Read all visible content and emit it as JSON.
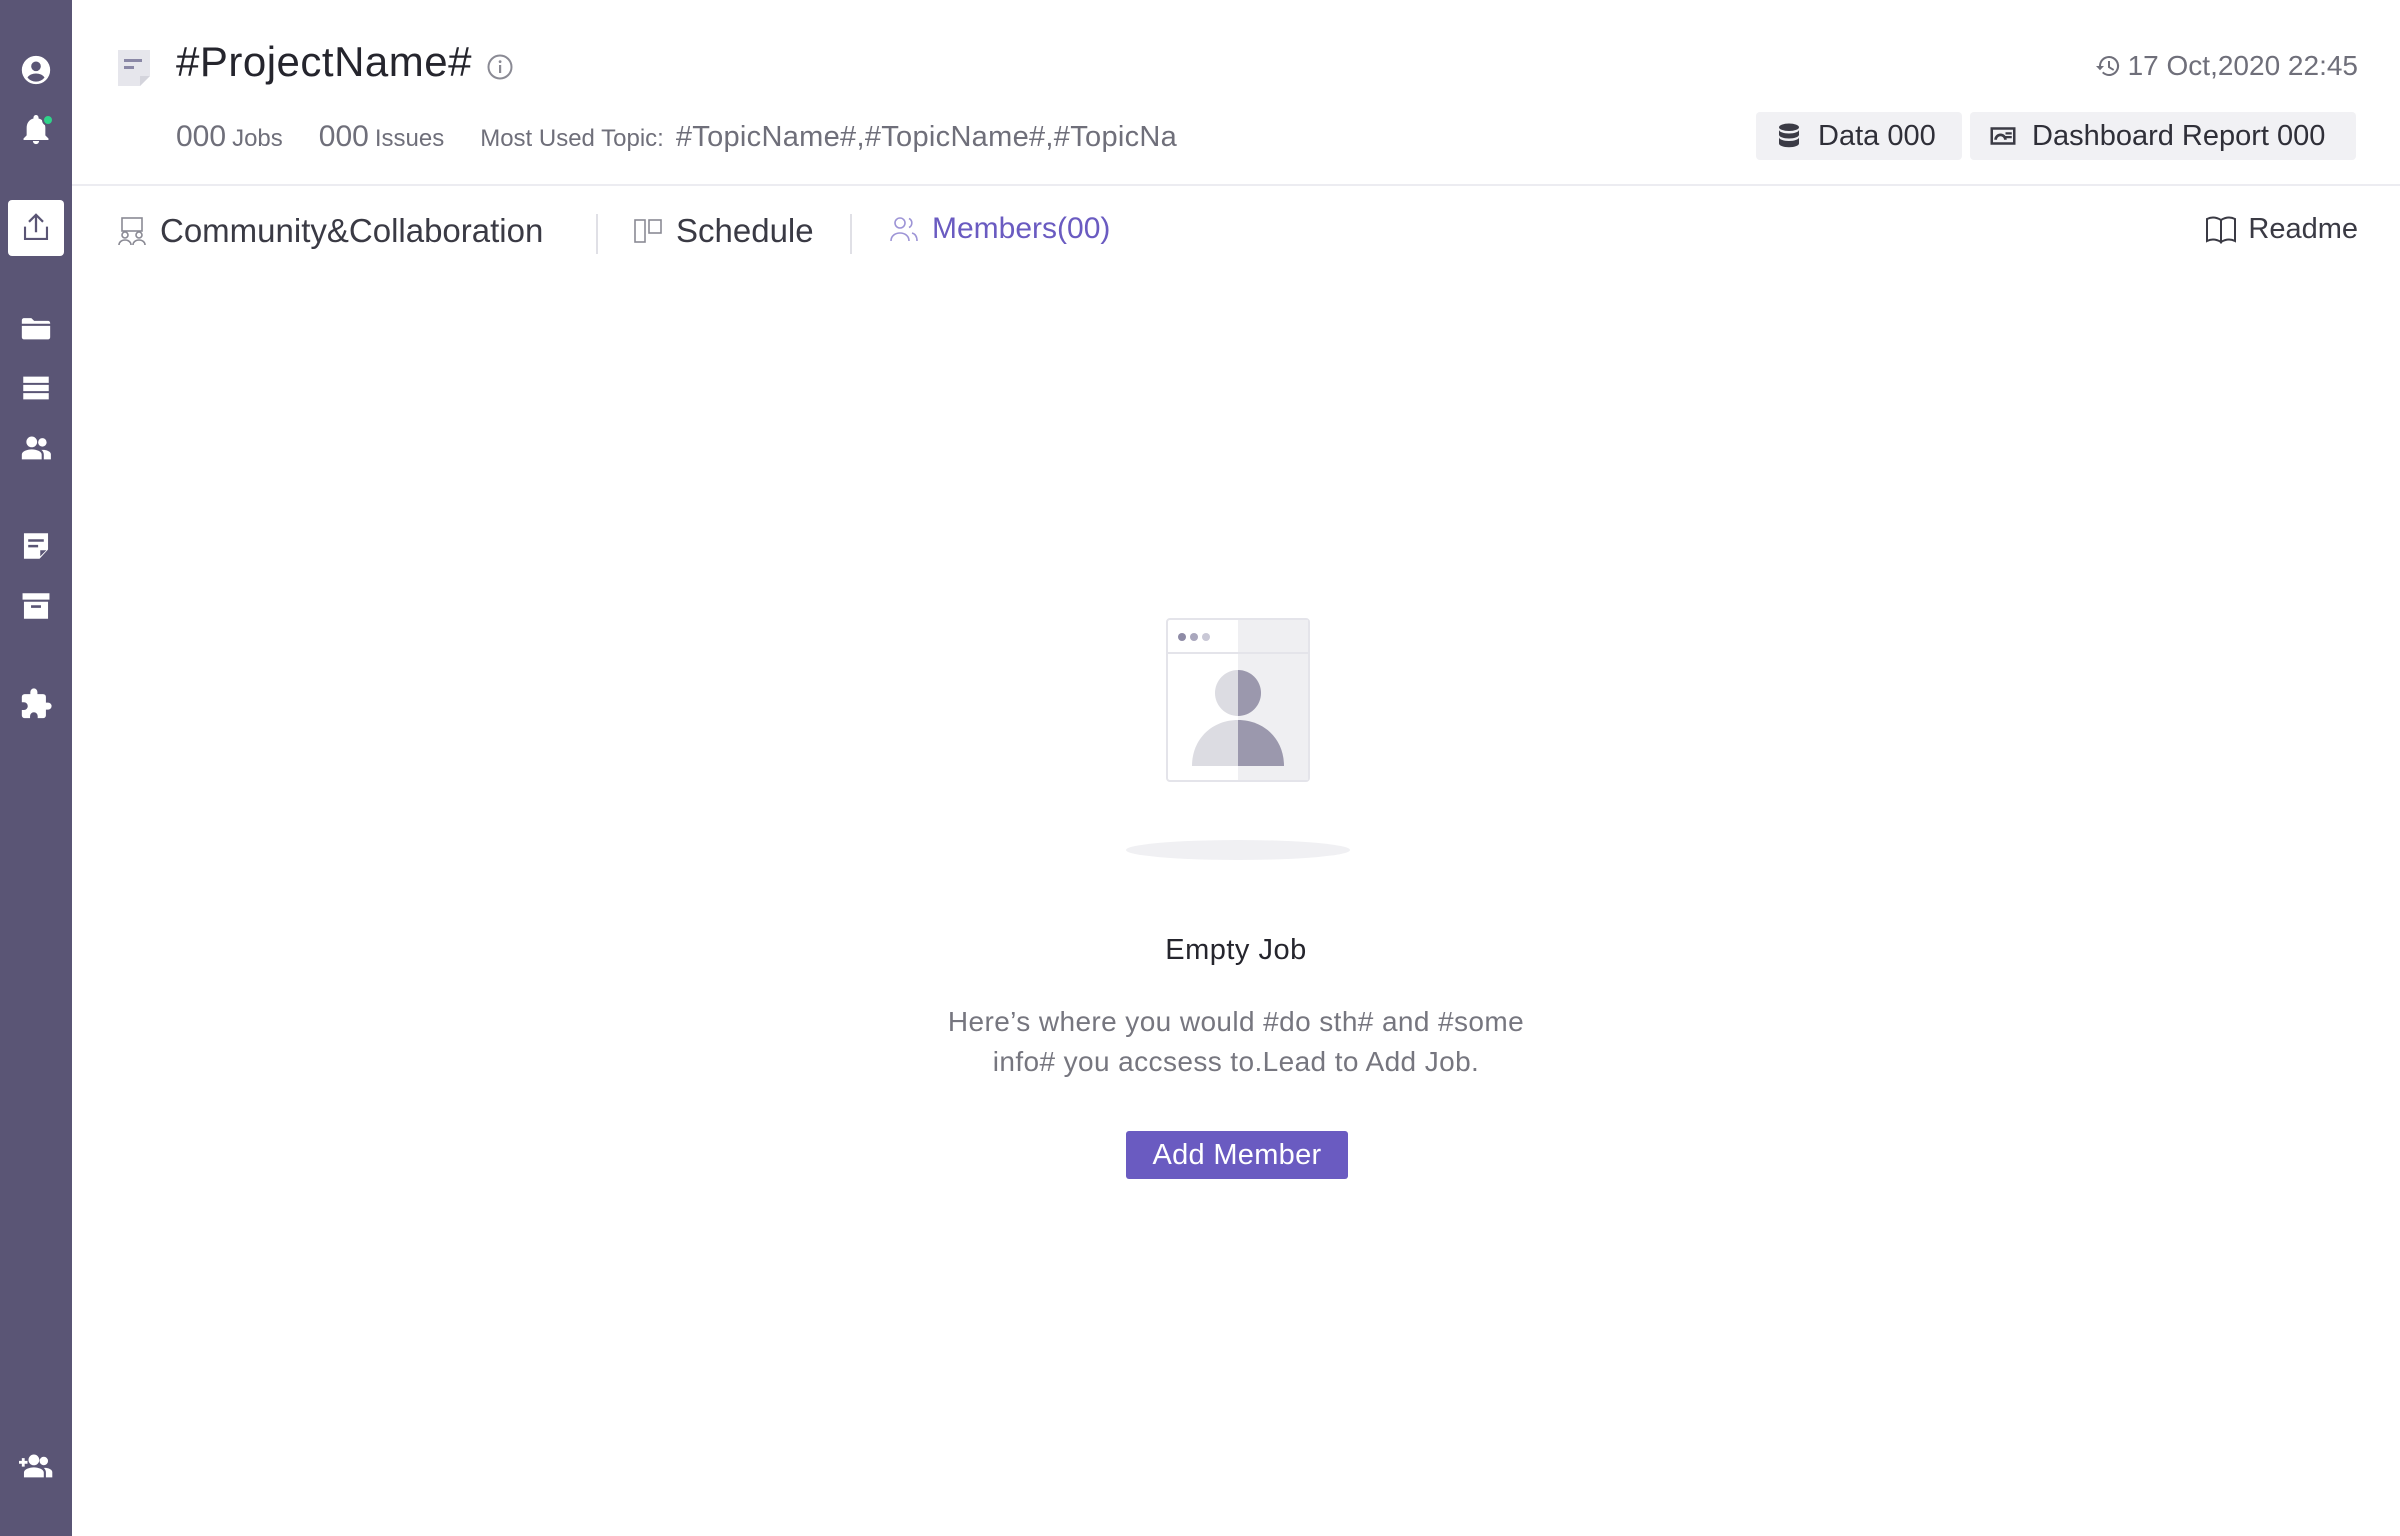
{
  "sidebar": {
    "items": [
      {
        "name": "profile-icon"
      },
      {
        "name": "notification-bell-icon"
      },
      {
        "name": "upload-icon"
      },
      {
        "name": "folder-icon"
      },
      {
        "name": "storage-list-icon"
      },
      {
        "name": "people-icon"
      },
      {
        "name": "note-icon"
      },
      {
        "name": "archive-icon"
      },
      {
        "name": "plugin-icon"
      },
      {
        "name": "add-user-icon"
      }
    ],
    "active_index": 2
  },
  "header": {
    "project_name": "#ProjectName#",
    "timestamp": "17 Oct,2020 22:45",
    "jobs_count": "000",
    "jobs_label": "Jobs",
    "issues_count": "000",
    "issues_label": "Issues",
    "topics_label": "Most Used Topic:",
    "topics_value": "#TopicName#,#TopicName#,#TopicNa",
    "data_chip": "Data 000",
    "dashboard_chip": "Dashboard Report 000"
  },
  "tabs": [
    {
      "label": "Community&Collaboration",
      "active": false
    },
    {
      "label": "Schedule",
      "active": false
    },
    {
      "label": "Members(00)",
      "active": true
    }
  ],
  "readme_label": "Readme",
  "empty_state": {
    "title": "Empty Job",
    "description_line1": "Here’s where you would #do sth# and #some",
    "description_line2": "info# you accsess to.Lead to Add Job.",
    "button_label": "Add Member"
  },
  "colors": {
    "sidebar_bg": "#5a5575",
    "accent": "#6a5bc1",
    "status_dot": "#2fd38a"
  }
}
